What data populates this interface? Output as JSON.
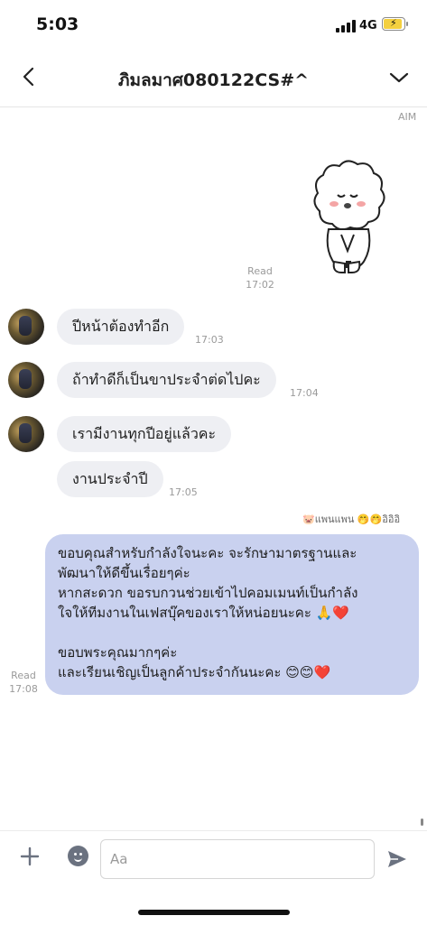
{
  "status_bar": {
    "time": "5:03",
    "network": "4G"
  },
  "header": {
    "title": "ภิมลมาศ080122CS#^"
  },
  "top_label": "AIM",
  "sticker_read": {
    "status": "Read",
    "time": "17:02"
  },
  "incoming": [
    {
      "text": "ปีหน้าต้องทำอีก",
      "time": "17:03"
    },
    {
      "text": "ถ้าทำดีก็เป็นขาประจำต่ดไปคะ",
      "time": "17:04"
    },
    {
      "text": "เรามีงานทุกปีอยู่แล้วคะ",
      "time": ""
    },
    {
      "text": "งานประจำปี",
      "time": "17:05"
    }
  ],
  "reply_to": "🐷แพนแพน 🤭🤭อิอิอิ",
  "outgoing": {
    "lines": [
      "ขอบคุณสำหรับกำลังใจนะคะ จะรักษามาตรฐานและ",
      "พัฒนาให้ดีขึ้นเรื่อยๆค่ะ",
      "หากสะดวก ขอรบกวนช่วยเข้าไปคอมเมนท์เป็นกำลัง",
      "ใจให้ทีมงานในเฟสบุ๊คของเราให้หน่อยนะคะ 🙏❤️",
      "",
      "ขอบพระคุณมากๆค่ะ",
      "และเรียนเชิญเป็นลูกค้าประจำกันนะคะ 😊😊❤️"
    ],
    "status": "Read",
    "time": "17:08"
  },
  "input": {
    "placeholder": "Aa"
  },
  "icons": {
    "back": "chevron-left-icon",
    "menu": "chevron-down-icon",
    "plus": "plus-icon",
    "emoji": "emoji-icon",
    "send": "send-icon"
  },
  "colors": {
    "outgoing_bubble": "#c9d1ef",
    "incoming_bubble": "#eeeff3",
    "battery": "#f4d03f"
  }
}
